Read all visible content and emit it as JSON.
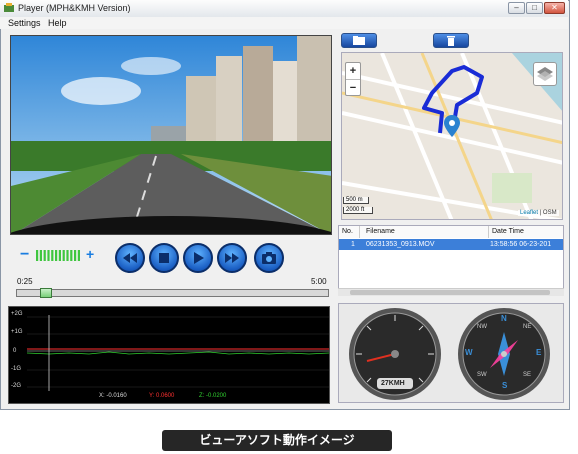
{
  "window": {
    "title": "Player (MPH&KMH Version)",
    "controls": [
      "minimize-icon",
      "maximize-icon",
      "close-icon"
    ]
  },
  "menu": {
    "items": [
      "Settings",
      "Help"
    ]
  },
  "toolbar": {
    "buttons": [
      "folder-icon",
      "trash-icon"
    ]
  },
  "map": {
    "zoom_in": "+",
    "zoom_out": "−",
    "scale_m": "500 m",
    "scale_ft": "2000 ft",
    "attribution_leaflet": "Leaflet",
    "attribution_osm": "| OSM",
    "layers_icon": "layers-icon",
    "marker_icon": "location-pin-icon",
    "route_color": "#1a2cd6"
  },
  "filelist": {
    "headers": [
      "No.",
      "Filename",
      "Date Time"
    ],
    "rows": [
      {
        "no": "1",
        "filename": "06231353_0913.MOV",
        "datetime": "13:58:56 06-23-201"
      }
    ]
  },
  "playback": {
    "volume_minus": "−",
    "volume_plus": "+",
    "volume_level": 1.0,
    "buttons": [
      "rewind-icon",
      "stop-icon",
      "play-icon",
      "fast-forward-icon",
      "snapshot-icon"
    ],
    "time_current": "0:25",
    "time_total": "5:00",
    "progress": 0.08
  },
  "gsensor": {
    "y_labels": [
      "+2G",
      "+1G",
      "0",
      "-1G",
      "-2G"
    ],
    "x_readout": "X: -0.0160",
    "y_readout": "Y: 0.0600",
    "z_readout": "Z: -0.0200",
    "colors": {
      "x": "#ffffff",
      "y": "#ff3030",
      "z": "#30d030"
    }
  },
  "gauges": {
    "speed_readout": "27KMH",
    "compass": {
      "n": "N",
      "s": "S",
      "e": "E",
      "w": "W",
      "ne": "NE",
      "nw": "NW",
      "se": "SE",
      "sw": "SW"
    }
  },
  "caption": "ビューアソフト動作イメージ"
}
